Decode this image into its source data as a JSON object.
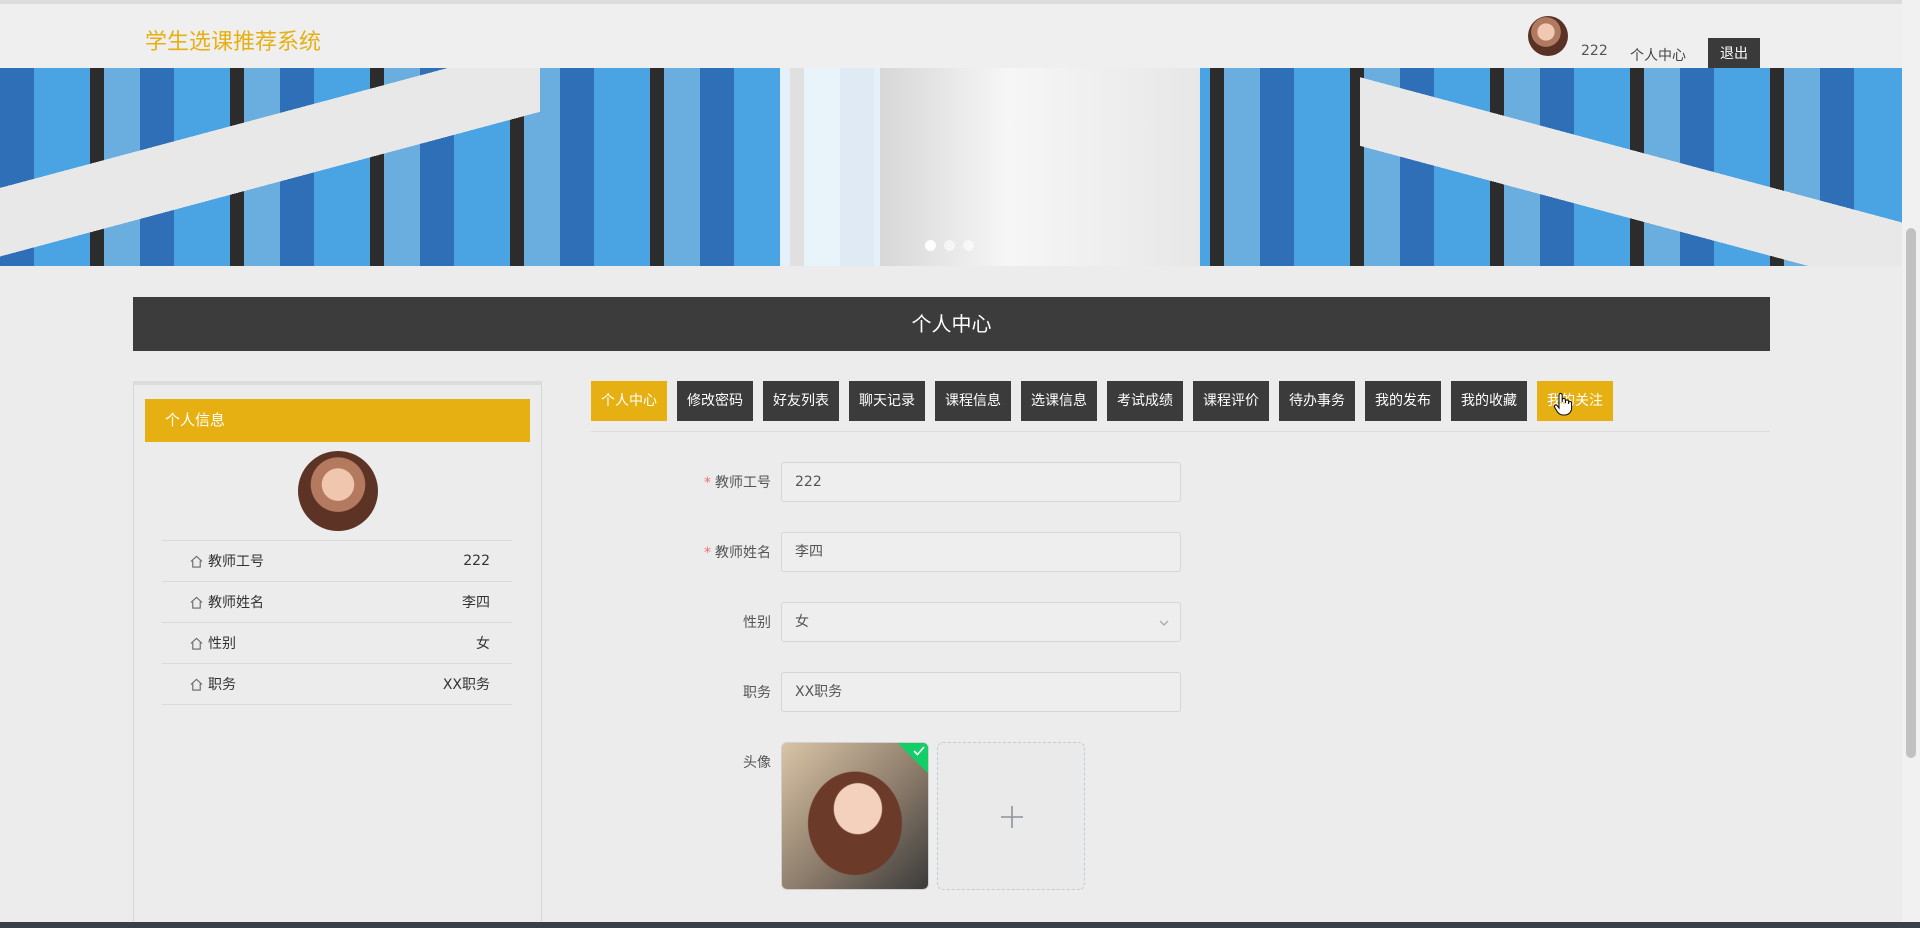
{
  "header": {
    "brand": "学生选课推荐系统",
    "username": "222",
    "center_link": "个人中心",
    "logout_label": "退出"
  },
  "banner": {
    "slides_count": 3,
    "active_slide": 1
  },
  "page": {
    "title": "个人中心"
  },
  "profile_panel": {
    "header": "个人信息",
    "rows": [
      {
        "label": "教师工号",
        "value": "222"
      },
      {
        "label": "教师姓名",
        "value": "李四"
      },
      {
        "label": "性别",
        "value": "女"
      },
      {
        "label": "职务",
        "value": "XX职务"
      }
    ]
  },
  "tabs": [
    {
      "label": "个人中心",
      "active": true
    },
    {
      "label": "修改密码"
    },
    {
      "label": "好友列表"
    },
    {
      "label": "聊天记录"
    },
    {
      "label": "课程信息"
    },
    {
      "label": "选课信息"
    },
    {
      "label": "考试成绩"
    },
    {
      "label": "课程评价"
    },
    {
      "label": "待办事务"
    },
    {
      "label": "我的发布"
    },
    {
      "label": "我的收藏"
    },
    {
      "label": "我的关注",
      "hover": true
    }
  ],
  "form": {
    "teacher_id": {
      "label": "教师工号",
      "value": "222",
      "required": true
    },
    "teacher_name": {
      "label": "教师姓名",
      "value": "李四",
      "required": true
    },
    "gender": {
      "label": "性别",
      "value": "女"
    },
    "position": {
      "label": "职务",
      "value": "XX职务"
    },
    "avatar": {
      "label": "头像"
    }
  },
  "colors": {
    "accent": "#e6b012",
    "dark": "#3b3b3b",
    "required": "#f56c6c",
    "success": "#13ce66"
  }
}
